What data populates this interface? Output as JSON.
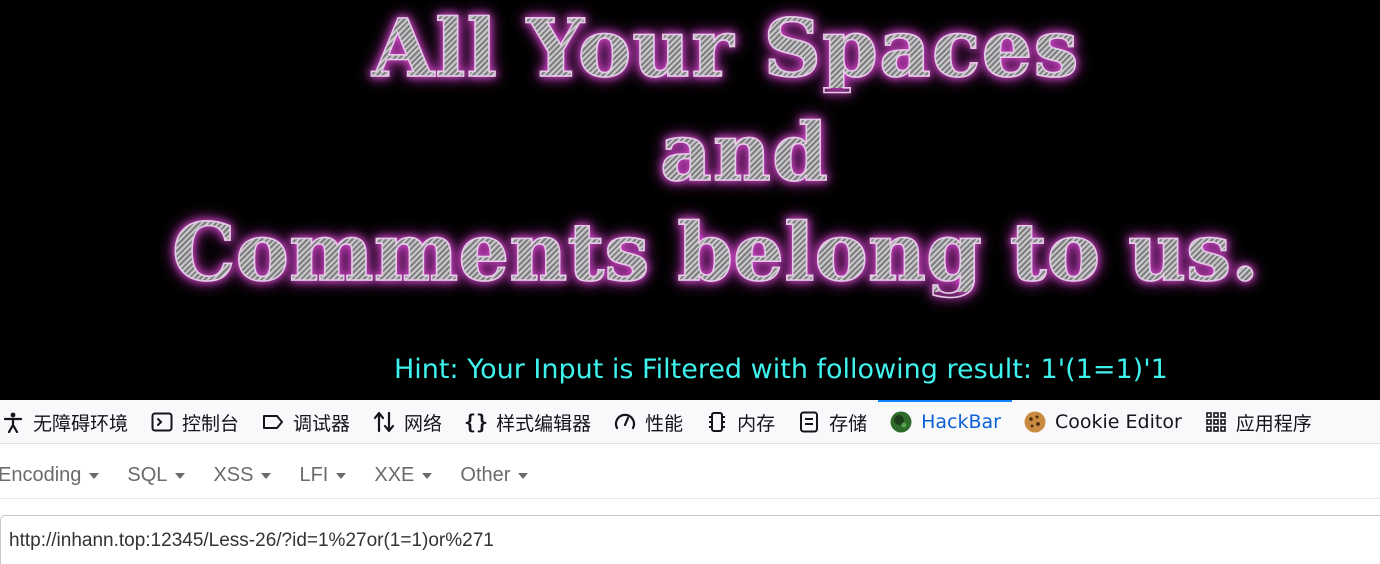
{
  "banner": {
    "line1": "All Your Spaces",
    "line2": "and",
    "line3": "Comments belong to us.",
    "hint": "Hint: Your Input is Filtered with following result: 1'(1=1)'1"
  },
  "devtools": {
    "tabs": [
      {
        "label": "无障碍环境",
        "icon": "accessibility-icon"
      },
      {
        "label": "控制台",
        "icon": "console-icon"
      },
      {
        "label": "调试器",
        "icon": "debugger-icon"
      },
      {
        "label": "网络",
        "icon": "network-icon"
      },
      {
        "label": "样式编辑器",
        "icon": "style-editor-icon"
      },
      {
        "label": "性能",
        "icon": "performance-icon"
      },
      {
        "label": "内存",
        "icon": "memory-icon"
      },
      {
        "label": "存储",
        "icon": "storage-icon"
      },
      {
        "label": "HackBar",
        "icon": "hackbar-icon",
        "active": true
      },
      {
        "label": "Cookie Editor",
        "icon": "cookie-icon"
      },
      {
        "label": "应用程序",
        "icon": "application-grid-icon"
      }
    ]
  },
  "hackbar": {
    "menus": [
      "Encoding",
      "SQL",
      "XSS",
      "LFI",
      "XXE",
      "Other"
    ],
    "url": "http://inhann.top:12345/Less-26/?id=1%27or(1=1)or%271"
  },
  "colors": {
    "hint": "#3ff2ee",
    "active_tab": "#0b62d6",
    "title_glow": "#d24dc9"
  }
}
